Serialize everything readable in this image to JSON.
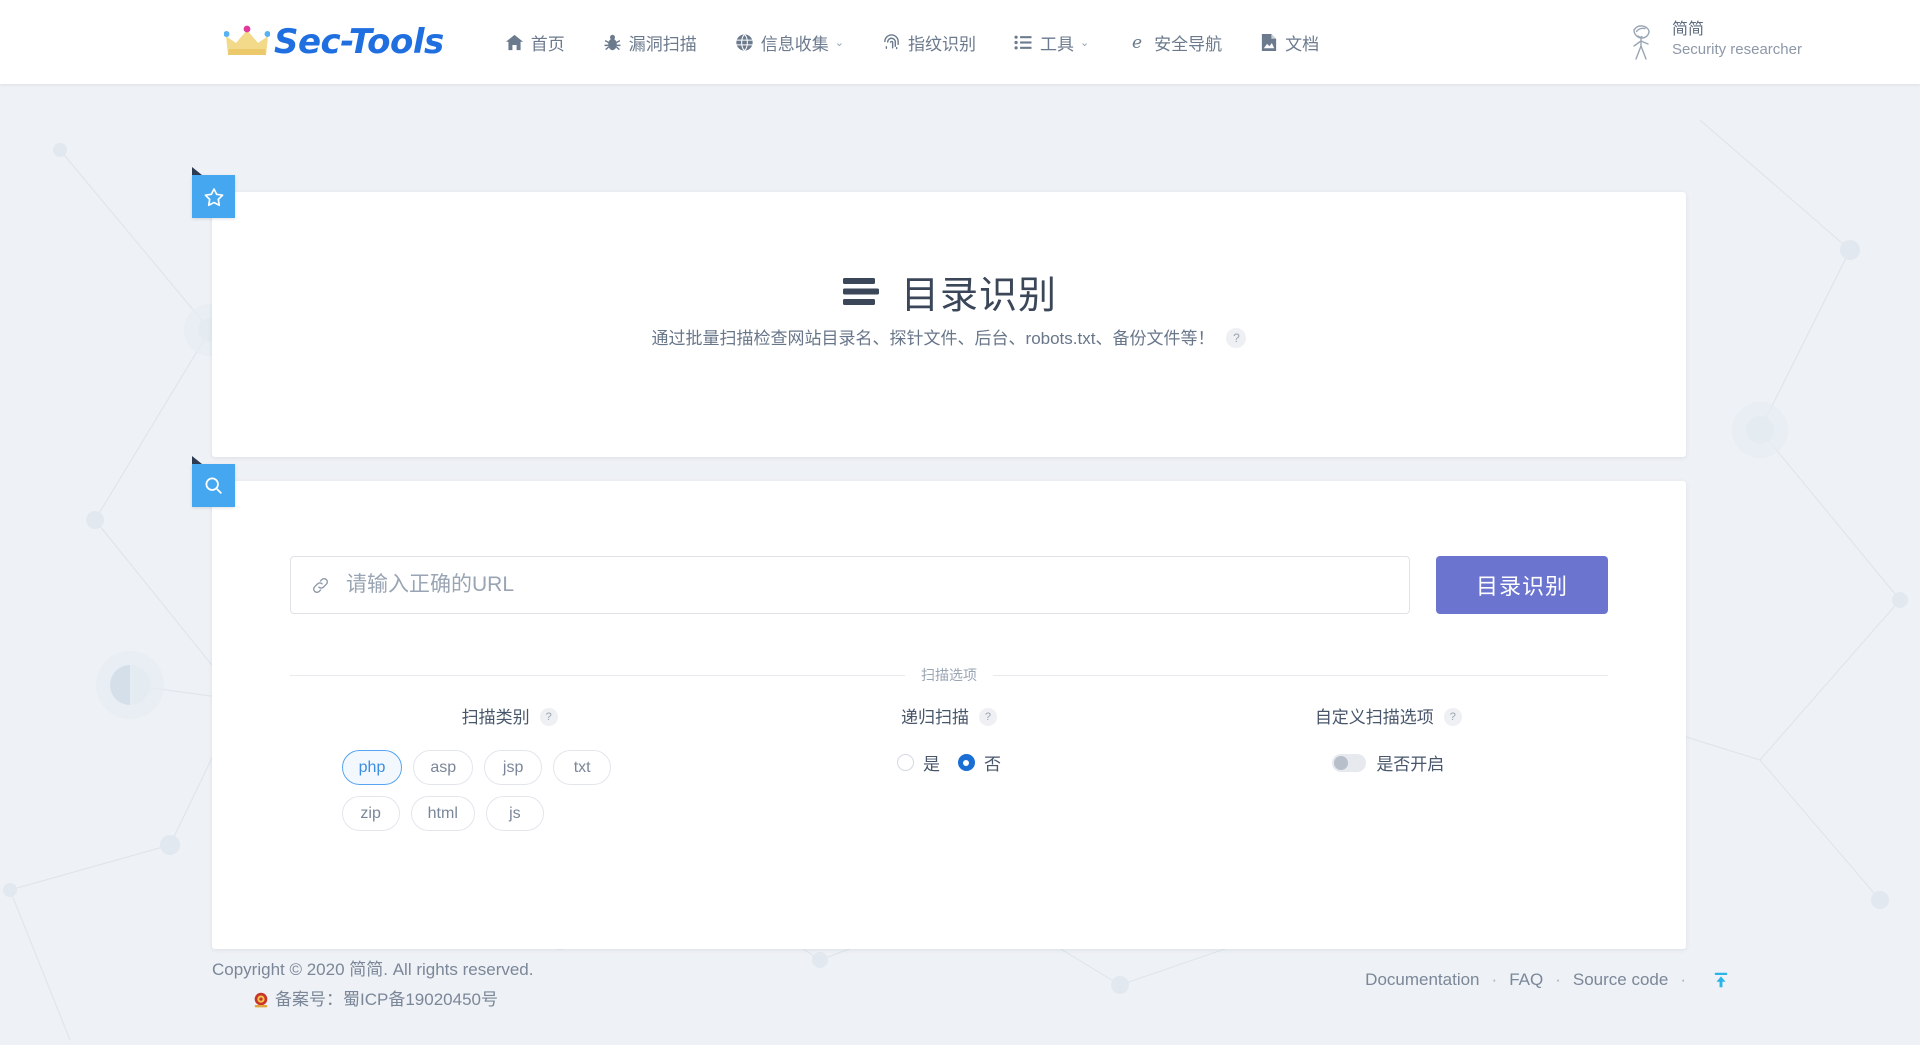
{
  "brand": {
    "name": "Sec-Tools",
    "icon": "crown-icon"
  },
  "nav": {
    "items": [
      {
        "label": "首页",
        "icon": "home-icon",
        "caret": false
      },
      {
        "label": "漏洞扫描",
        "icon": "bug-icon",
        "caret": false
      },
      {
        "label": "信息收集",
        "icon": "globe-icon",
        "caret": true
      },
      {
        "label": "指纹识别",
        "icon": "fingerprint-icon",
        "caret": false
      },
      {
        "label": "工具",
        "icon": "list-icon",
        "caret": true
      },
      {
        "label": "安全导航",
        "icon": "explorer-e-icon",
        "caret": false
      },
      {
        "label": "文档",
        "icon": "document-icon",
        "caret": false
      }
    ],
    "caret_glyph": "⌄"
  },
  "user": {
    "name": "简简",
    "role": "Security researcher",
    "avatar_icon": "person-sketch-avatar"
  },
  "intro": {
    "badge_icon": "star-icon",
    "title_icon": "list-lines-icon",
    "title": "目录识别",
    "description": "通过批量扫描检查网站目录名、探针文件、后台、robots.txt、备份文件等！",
    "help_glyph": "?"
  },
  "scan": {
    "badge_icon": "search-icon",
    "url_input": {
      "icon": "link-icon",
      "value": "",
      "placeholder": "请输入正确的URL"
    },
    "submit_label": "目录识别",
    "divider_label": "扫描选项",
    "help_glyph": "?",
    "category": {
      "label": "扫描类别",
      "chips": [
        {
          "label": "php",
          "selected": true
        },
        {
          "label": "asp",
          "selected": false
        },
        {
          "label": "jsp",
          "selected": false
        },
        {
          "label": "txt",
          "selected": false
        },
        {
          "label": "zip",
          "selected": false
        },
        {
          "label": "html",
          "selected": false
        },
        {
          "label": "js",
          "selected": false
        }
      ]
    },
    "recursive": {
      "label": "递归扫描",
      "options": [
        {
          "label": "是",
          "selected": false
        },
        {
          "label": "否",
          "selected": true
        }
      ]
    },
    "custom": {
      "label": "自定义扫描选项",
      "toggle_label": "是否开启",
      "enabled": false
    }
  },
  "footer": {
    "copyright": "Copyright © 2020 简简. All rights reserved.",
    "icp_prefix": "备案号：",
    "icp_number": "蜀ICP备19020450号",
    "icp_icon": "police-badge-icon",
    "links": [
      {
        "label": "Documentation"
      },
      {
        "label": "FAQ"
      },
      {
        "label": "Source code"
      }
    ],
    "separator": "·",
    "to_top_icon": "arrow-to-top-icon"
  },
  "colors": {
    "brand_blue": "#1f6fe0",
    "badge_blue": "#45a7ef",
    "submit_purple": "#6b74cf",
    "radio_blue": "#1b6fd4",
    "chip_selected_border": "#57a5f0",
    "page_bg": "#eef1f5"
  }
}
